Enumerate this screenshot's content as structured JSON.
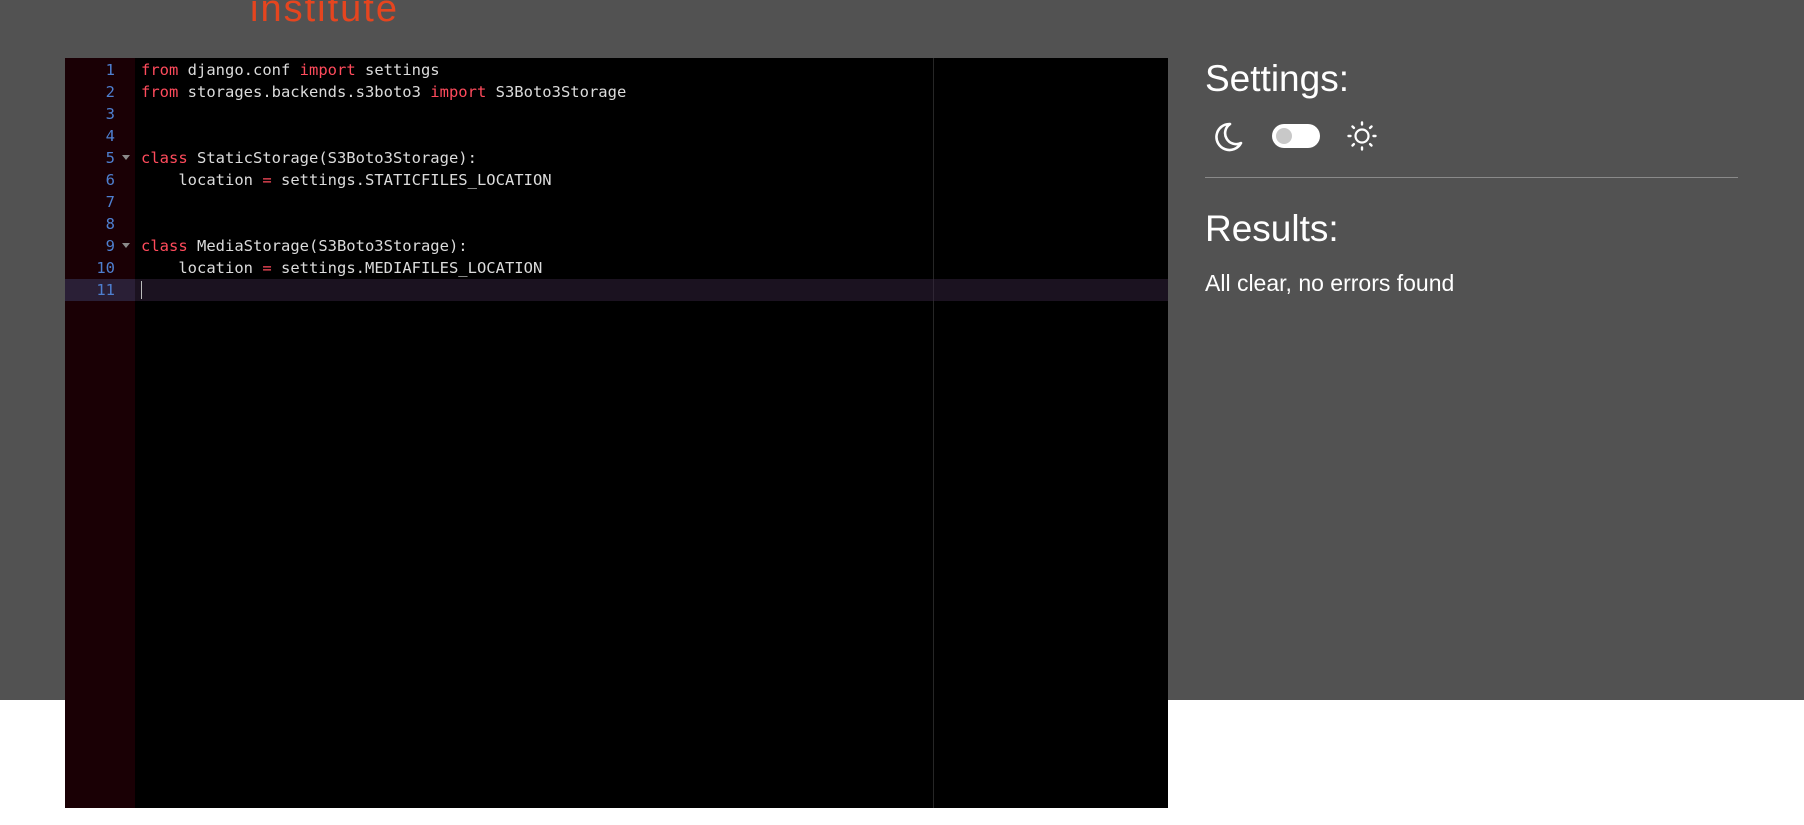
{
  "header": {
    "logo_text": "institute"
  },
  "editor": {
    "lines": [
      {
        "n": "1",
        "fold": false,
        "tokens": [
          {
            "t": "from",
            "kw": true
          },
          {
            "t": " django.conf "
          },
          {
            "t": "import",
            "kw": true
          },
          {
            "t": " settings"
          }
        ]
      },
      {
        "n": "2",
        "fold": false,
        "tokens": [
          {
            "t": "from",
            "kw": true
          },
          {
            "t": " storages.backends.s3boto3 "
          },
          {
            "t": "import",
            "kw": true
          },
          {
            "t": " S3Boto3Storage"
          }
        ]
      },
      {
        "n": "3",
        "fold": false,
        "tokens": []
      },
      {
        "n": "4",
        "fold": false,
        "tokens": []
      },
      {
        "n": "5",
        "fold": true,
        "tokens": [
          {
            "t": "class",
            "kw": true
          },
          {
            "t": " StaticStorage(S3Boto3Storage):"
          }
        ]
      },
      {
        "n": "6",
        "fold": false,
        "tokens": [
          {
            "t": "    location "
          },
          {
            "t": "=",
            "kw": true
          },
          {
            "t": " settings.STATICFILES_LOCATION"
          }
        ]
      },
      {
        "n": "7",
        "fold": false,
        "tokens": []
      },
      {
        "n": "8",
        "fold": false,
        "tokens": []
      },
      {
        "n": "9",
        "fold": true,
        "tokens": [
          {
            "t": "class",
            "kw": true
          },
          {
            "t": " MediaStorage(S3Boto3Storage):"
          }
        ]
      },
      {
        "n": "10",
        "fold": false,
        "tokens": [
          {
            "t": "    location "
          },
          {
            "t": "=",
            "kw": true
          },
          {
            "t": " settings.MEDIAFILES_LOCATION"
          }
        ]
      },
      {
        "n": "11",
        "fold": false,
        "active": true,
        "tokens": []
      }
    ]
  },
  "settings": {
    "title": "Settings:",
    "dark_mode_icon": "moon-icon",
    "light_mode_icon": "sun-icon",
    "theme_toggle_state": "off"
  },
  "results": {
    "title": "Results:",
    "message": "All clear, no errors found"
  },
  "colors": {
    "background": "#525252",
    "logo": "#e5451f",
    "keyword": "#ff4b5c",
    "line_number": "#4e7fd0"
  }
}
